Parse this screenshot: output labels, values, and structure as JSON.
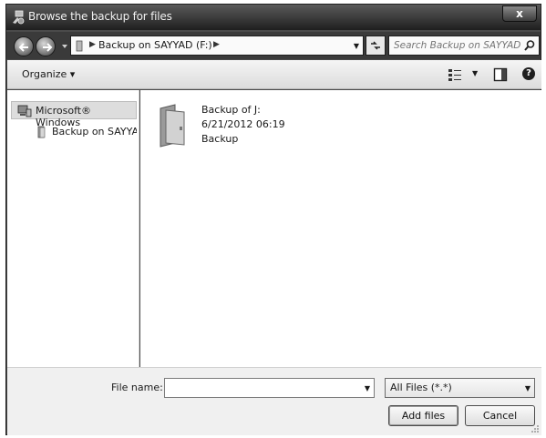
{
  "window": {
    "title": "Browse the backup for files",
    "close_label": "x"
  },
  "navigation": {
    "breadcrumb": "Backup on SAYYAD (F:)",
    "search_placeholder": "Search Backup on SAYYAD (F:)"
  },
  "toolbar": {
    "organize_label": "Organize ▾"
  },
  "sidebar": {
    "items": [
      {
        "label": "Microsoft® Windows",
        "icon": "computer-icon",
        "selected": true
      },
      {
        "label": "Backup on SAYYAD",
        "icon": "folder-icon",
        "selected": false
      }
    ]
  },
  "files": [
    {
      "name": "Backup of J:",
      "date": "6/21/2012 06:19",
      "type": "Backup",
      "icon": "folder-icon"
    }
  ],
  "footer": {
    "file_name_label": "File name:",
    "file_name_value": "",
    "filter_value": "All Files (*.*)",
    "add_button": "Add files",
    "cancel_button": "Cancel"
  }
}
